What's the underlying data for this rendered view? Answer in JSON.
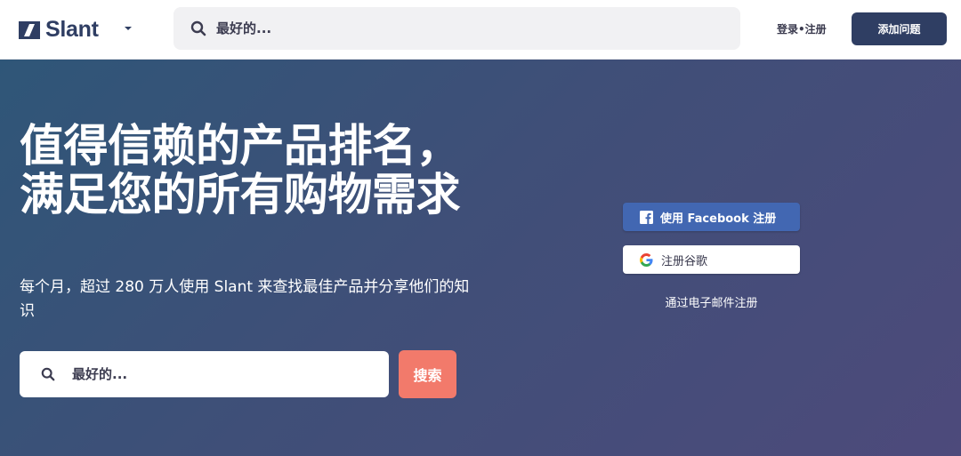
{
  "header": {
    "logo_text": "Slant",
    "search_placeholder": "最好的...",
    "login_label": "登录•注册",
    "ask_button_label": "添加问题"
  },
  "hero": {
    "title": "值得信赖的产品排名，满足您的所有购物需求",
    "subtitle": "每个月，超过 280 万人使用 Slant 来查找最佳产品并分享他们的知识",
    "search_placeholder": "最好的...",
    "search_button_label": "搜索"
  },
  "signup": {
    "facebook_label": "使用 Facebook 注册",
    "google_label": "注册谷歌",
    "email_label": "通过电子邮件注册"
  },
  "colors": {
    "brand": "#2f3e63",
    "accent": "#f27a6b",
    "facebook": "#4267b2"
  },
  "icons": [
    "slant-logo-icon",
    "chevron-down-icon",
    "search-icon",
    "facebook-icon",
    "google-icon"
  ]
}
